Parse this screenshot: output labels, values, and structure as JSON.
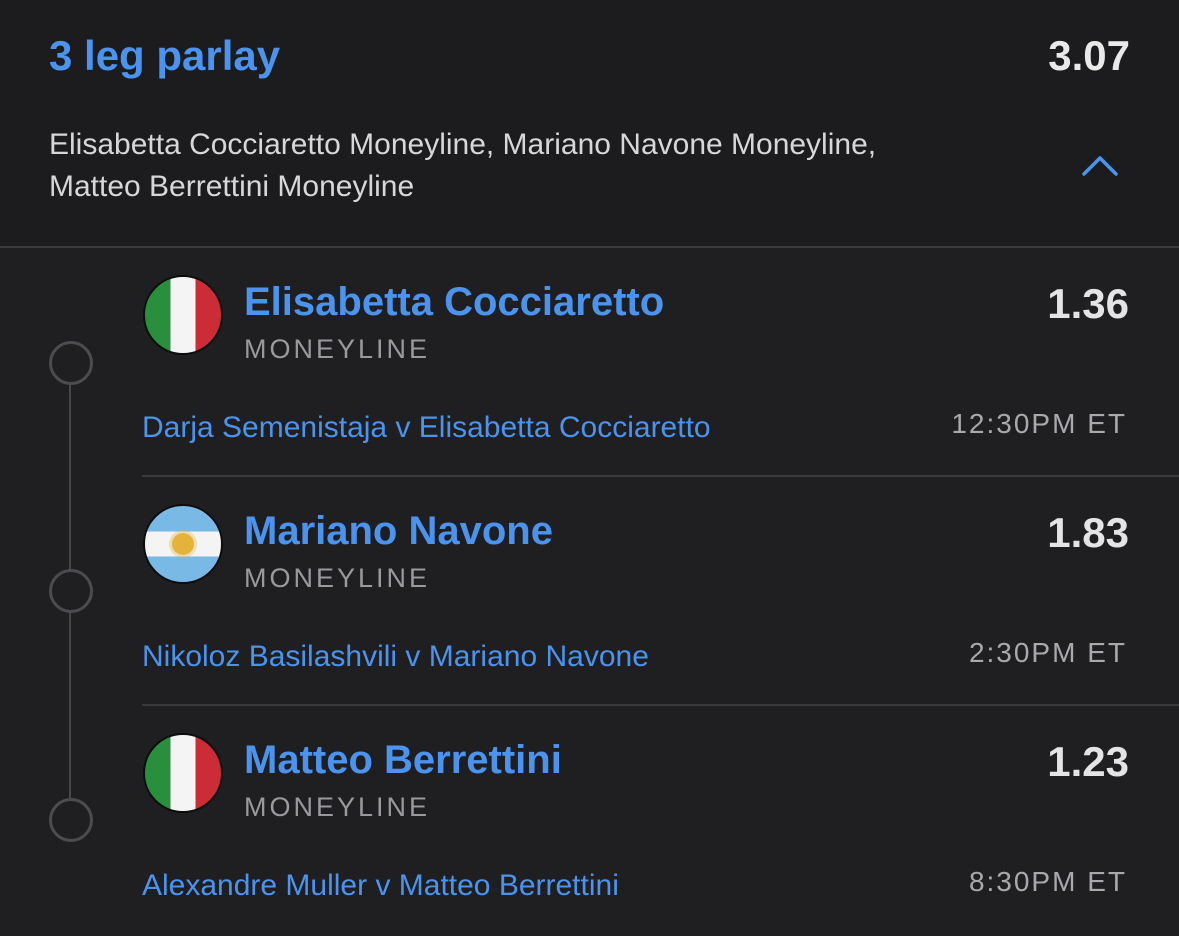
{
  "header": {
    "title": "3 leg parlay",
    "total_odds": "3.07",
    "summary_line1": "Elisabetta Cocciaretto Moneyline, Mariano Navone Moneyline,",
    "summary_line2": "Matteo Berrettini Moneyline",
    "toggle_icon": "chevron-up-icon"
  },
  "legs": [
    {
      "flag": "italy-flag-icon",
      "player": "Elisabetta Cocciaretto",
      "market": "MONEYLINE",
      "odds": "1.36",
      "match": "Darja Semenistaja v Elisabetta Cocciaretto",
      "time": "12:30PM ET"
    },
    {
      "flag": "argentina-flag-icon",
      "player": "Mariano Navone",
      "market": "MONEYLINE",
      "odds": "1.83",
      "match": "Nikoloz Basilashvili v Mariano Navone",
      "time": "2:30PM ET"
    },
    {
      "flag": "italy-flag-icon",
      "player": "Matteo Berrettini",
      "market": "MONEYLINE",
      "odds": "1.23",
      "match": "Alexandre Muller v Matteo Berrettini",
      "time": "8:30PM ET"
    }
  ],
  "colors": {
    "accent": "#4a94f0",
    "background": "#1f1f21",
    "header_background": "#1c1c1e",
    "divider": "#3a3a3d"
  }
}
